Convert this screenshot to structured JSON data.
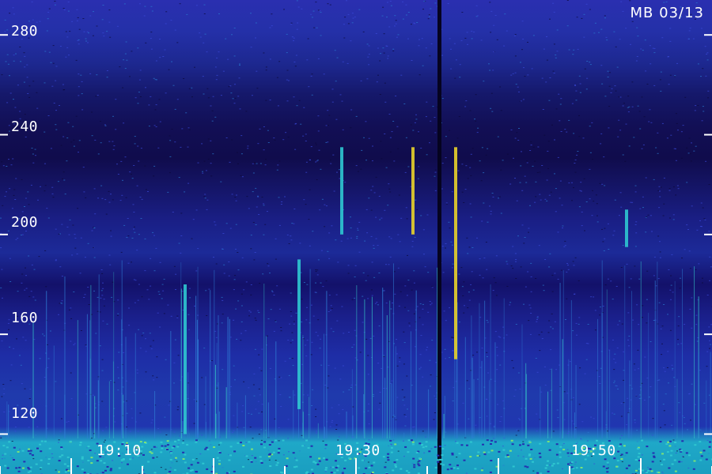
{
  "chart_data": {
    "type": "heatmap",
    "title": "MB 03/13",
    "y_ticks": [
      {
        "value": 280,
        "label": "280"
      },
      {
        "value": 240,
        "label": "240"
      },
      {
        "value": 200,
        "label": "200"
      },
      {
        "value": 160,
        "label": "160"
      },
      {
        "value": 120,
        "label": "120"
      }
    ],
    "x_labels": [
      {
        "time": "19:10",
        "label": "19:10"
      },
      {
        "time": "19:30",
        "label": "19:30"
      },
      {
        "time": "19:50",
        "label": "19:50"
      }
    ],
    "x_range_minutes": [
      "19:05",
      "19:55"
    ],
    "y_range": [
      104,
      294
    ],
    "colormap": [
      "#1a0f4d",
      "#2430b0",
      "#2f6ad8",
      "#2fc6d0",
      "#7ae27a",
      "#e8d22a"
    ],
    "features": [
      {
        "type": "vertical-burst",
        "time": "19:18",
        "freq_from": 120,
        "freq_to": 180,
        "intensity": 0.6
      },
      {
        "type": "vertical-burst",
        "time": "19:26",
        "freq_from": 130,
        "freq_to": 190,
        "intensity": 0.55
      },
      {
        "type": "vertical-burst",
        "time": "19:29",
        "freq_from": 200,
        "freq_to": 235,
        "intensity": 0.55
      },
      {
        "type": "vertical-burst",
        "time": "19:34",
        "freq_from": 200,
        "freq_to": 235,
        "intensity": 0.95
      },
      {
        "type": "vertical-burst",
        "time": "19:37",
        "freq_from": 150,
        "freq_to": 235,
        "intensity": 0.9
      },
      {
        "type": "vertical-burst",
        "time": "19:49",
        "freq_from": 195,
        "freq_to": 210,
        "intensity": 0.65
      }
    ]
  }
}
